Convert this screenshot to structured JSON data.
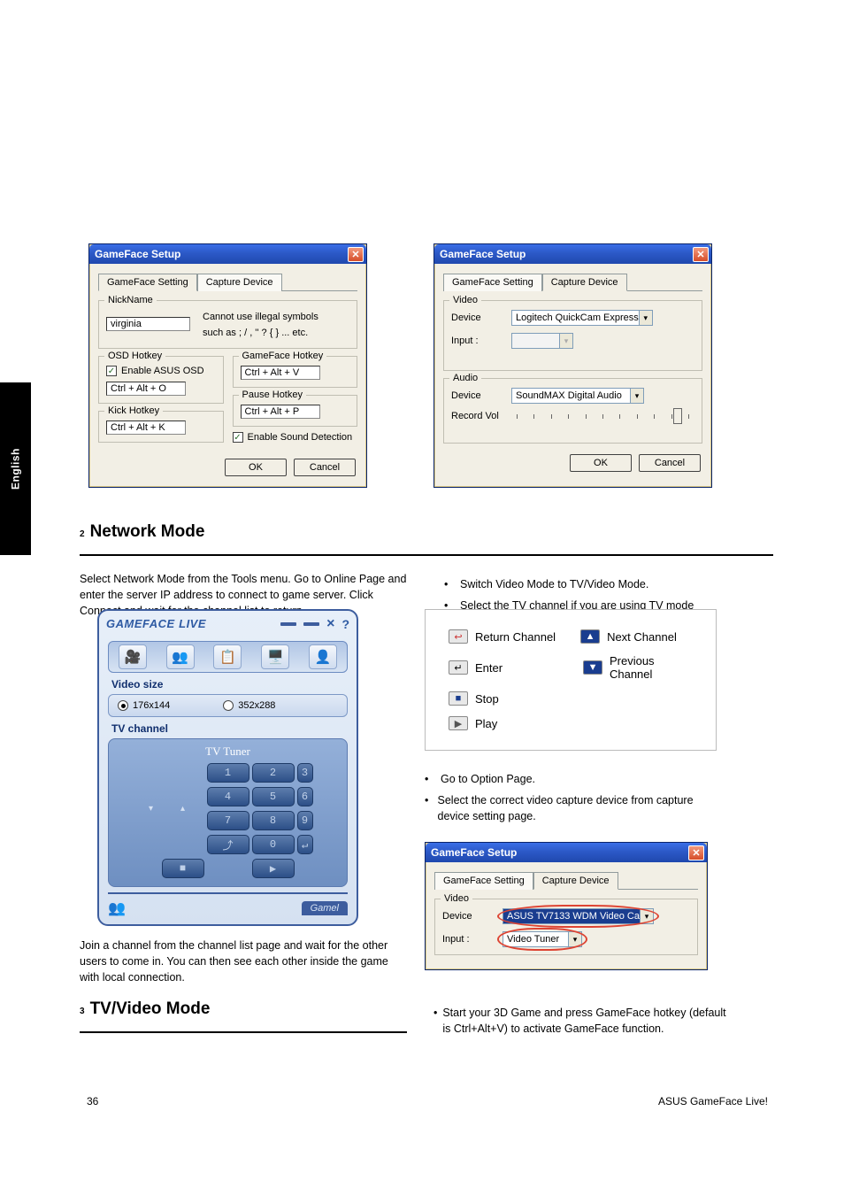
{
  "side_tab": "English",
  "footer_left": "36",
  "footer_right": "ASUS GameFace Live!",
  "dlg1": {
    "title": "GameFace Setup",
    "tab_setting": "GameFace Setting",
    "tab_capture": "Capture Device",
    "nickname_legend": "NickName",
    "nickname_value": "virginia",
    "hint1": "Cannot use illegal symbols",
    "hint2": "such as ; / , '' ? { } ... etc.",
    "osd_legend": "OSD Hotkey",
    "osd_check": "Enable ASUS OSD",
    "osd_hotkey": "Ctrl + Alt + O",
    "kick_legend": "Kick Hotkey",
    "kick_hotkey": "Ctrl + Alt + K",
    "gf_legend": "GameFace Hotkey",
    "gf_hotkey": "Ctrl + Alt + V",
    "pause_legend": "Pause Hotkey",
    "pause_hotkey": "Ctrl + Alt + P",
    "sound_check": "Enable Sound Detection",
    "ok": "OK",
    "cancel": "Cancel"
  },
  "dlg2": {
    "title": "GameFace Setup",
    "tab_setting": "GameFace Setting",
    "tab_capture": "Capture Device",
    "video_legend": "Video",
    "device_lbl": "Device",
    "video_device": "Logitech QuickCam Express",
    "input_lbl": "Input :",
    "audio_legend": "Audio",
    "audio_device": "SoundMAX Digital Audio",
    "record_lbl": "Record Vol",
    "ok": "OK",
    "cancel": "Cancel"
  },
  "sec2": {
    "num": "2",
    "title": "Network Mode",
    "p1": "Select Network Mode from the Tools menu. Go to Online Page and enter the server IP address to connect to game server. Click Connect and wait for the channel list to return.",
    "p2": "Join a channel from the channel list page and wait for the other users to come in. You can then see each other inside the game with local connection."
  },
  "sec3": {
    "num": "3",
    "title": "TV/Video Mode",
    "b1": "Switch Video Mode to TV/Video Mode.",
    "b2": "Select the TV channel if you are using TV mode",
    "b3": "Go to Option Page.",
    "b4": "Select the correct video capture device from capture device setting page.",
    "b5": "Start your 3D Game and press GameFace hotkey (default is Ctrl+Alt+V) to activate GameFace function."
  },
  "gfl": {
    "logo": "GAMEFACE",
    "logo_live": "LIVE",
    "video_size": "Video size",
    "r1": "176x144",
    "r2": "352x288",
    "tv_channel": "TV channel",
    "tv_tuner": "TV Tuner",
    "tab_gamel": "Gamel"
  },
  "legend": {
    "return_ch": "Return Channel",
    "next_ch": "Next Channel",
    "enter": "Enter",
    "prev_ch": "Previous Channel",
    "stop": "Stop",
    "play": "Play"
  },
  "dlg3": {
    "title": "GameFace Setup",
    "tab_setting": "GameFace Setting",
    "tab_capture": "Capture Device",
    "video_legend": "Video",
    "device_lbl": "Device",
    "video_device": "ASUS TV7133 WDM Video Ca",
    "input_lbl": "Input :",
    "input_value": "Video Tuner"
  }
}
